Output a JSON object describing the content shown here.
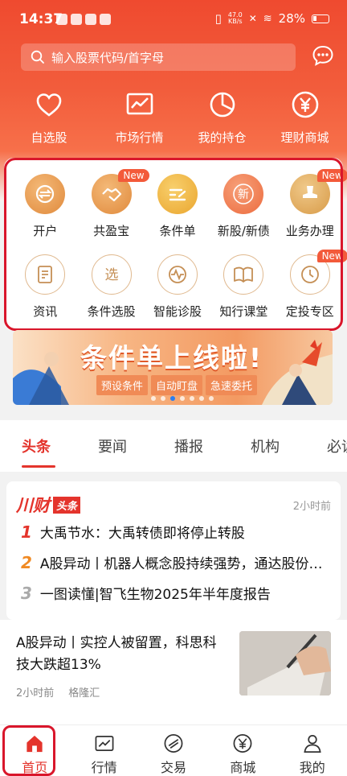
{
  "status": {
    "time": "14:37",
    "speed": "47.0\nKB/s",
    "battery": "28%"
  },
  "search": {
    "placeholder": "输入股票代码/首字母"
  },
  "quick": [
    {
      "label": "自选股",
      "icon": "heart-icon"
    },
    {
      "label": "市场行情",
      "icon": "chart-icon"
    },
    {
      "label": "我的持仓",
      "icon": "pie-icon"
    },
    {
      "label": "理财商城",
      "icon": "yuan-icon"
    }
  ],
  "grid": [
    {
      "label": "开户",
      "icon": "open-account-icon",
      "new": ""
    },
    {
      "label": "共盈宝",
      "icon": "handshake-icon",
      "new": "New"
    },
    {
      "label": "条件单",
      "icon": "condition-icon",
      "new": ""
    },
    {
      "label": "新股/新债",
      "icon": "new-stock-icon",
      "new": ""
    },
    {
      "label": "业务办理",
      "icon": "stamp-icon",
      "new": "New"
    },
    {
      "label": "资讯",
      "icon": "document-icon",
      "new": ""
    },
    {
      "label": "条件选股",
      "icon": "select-icon",
      "new": ""
    },
    {
      "label": "智能诊股",
      "icon": "diagnose-icon",
      "new": ""
    },
    {
      "label": "知行课堂",
      "icon": "book-icon",
      "new": ""
    },
    {
      "label": "定投专区",
      "icon": "clock-icon",
      "new": "New"
    }
  ],
  "new_badge": "New",
  "banner": {
    "title": "条件单上线啦!",
    "tags": [
      "预设条件",
      "自动盯盘",
      "急速委托"
    ]
  },
  "tabs": [
    "头条",
    "要闻",
    "播报",
    "机构",
    "必读"
  ],
  "news": {
    "brand": "川财",
    "tag": "头条",
    "time": "2小时前",
    "items": [
      {
        "num": "1",
        "text": "大禹节水：大禹转债即将停止转股",
        "color": "#e4342c"
      },
      {
        "num": "2",
        "text": "A股异动丨机器人概念股持续强势，通达股份涨超10%",
        "color": "#f08a24"
      },
      {
        "num": "3",
        "text": "一图读懂|智飞生物2025年半年度报告",
        "color": "#aaaaaa"
      }
    ]
  },
  "article": {
    "title": "A股异动丨实控人被留置，科思科技大跌超13%",
    "time": "2小时前",
    "source": "格隆汇"
  },
  "nav": [
    {
      "label": "首页",
      "icon": "home-icon"
    },
    {
      "label": "行情",
      "icon": "market-icon"
    },
    {
      "label": "交易",
      "icon": "trade-icon"
    },
    {
      "label": "商城",
      "icon": "mall-icon"
    },
    {
      "label": "我的",
      "icon": "profile-icon"
    }
  ]
}
